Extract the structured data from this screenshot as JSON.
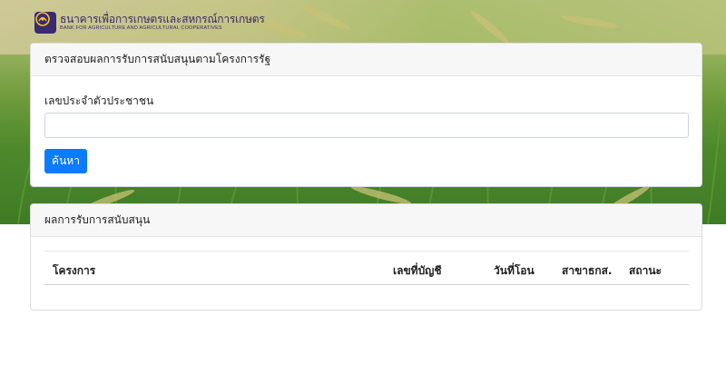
{
  "brand": {
    "name_th": "ธนาคารเพื่อการเกษตรและสหกรณ์การเกษตร",
    "name_en": "BANK FOR AGRICULTURE AND AGRICULTURAL COOPERATIVES",
    "logo_icon": "baac-logo-icon",
    "color": "#3a2a6e"
  },
  "search_card": {
    "title": "ตรวจสอบผลการรับการสนับสนุนตามโครงการรัฐ",
    "id_label": "เลขประจำตัวประชาชน",
    "id_value": "",
    "search_button": "ค้นหา",
    "accent_color": "#0d7bfd"
  },
  "results_card": {
    "title": "ผลการรับการสนับสนุน",
    "columns": [
      "โครงการ",
      "เลขที่บัญชี",
      "วันที่โอน",
      "สาขาธกส.",
      "สถานะ"
    ],
    "rows": []
  }
}
